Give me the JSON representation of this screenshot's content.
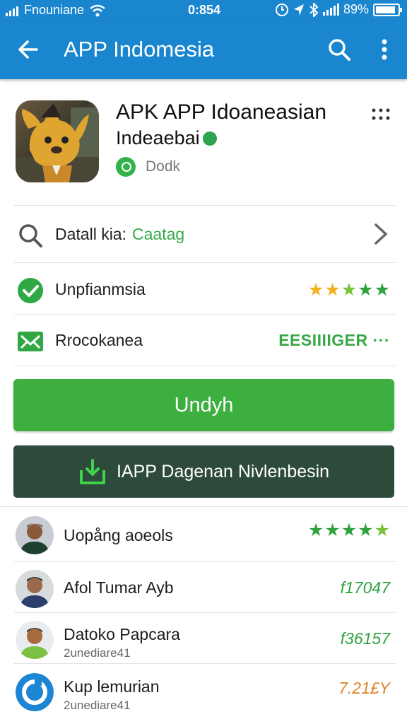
{
  "status_bar": {
    "carrier": "Fnouniane",
    "time": "0:854",
    "battery": "89%",
    "battery_level": 0.89
  },
  "app_bar": {
    "title": "APP Indomesia",
    "back_icon": "arrow-left-icon",
    "search_icon": "search-icon",
    "more_icon": "more-vert-icon"
  },
  "app": {
    "name": "APK APP Idoaneasian",
    "subtitle": "Indeaebai",
    "developer": "Dodk",
    "icon": "mascot-app-icon"
  },
  "info_rows": [
    {
      "label": "Datall kia:",
      "value": "Caatag",
      "icon": "search-icon"
    },
    {
      "label": "Unpfianmsia",
      "icon": "check-circle-icon",
      "rating": 5
    },
    {
      "label": "Rrocokanea",
      "icon": "mail-icon",
      "value": "EESIIIIGER ···"
    }
  ],
  "buttons": {
    "download": "Undyh",
    "secondary": "IAPP Dagenan Nivlenbesin"
  },
  "reviews": [
    {
      "name": "Uopång aoeols",
      "rating": 5,
      "score": ""
    },
    {
      "name": "Afol Tumar Ayb",
      "sub": "",
      "score": "f17047"
    },
    {
      "name": "Datoko Papcara",
      "sub": "2unediare41",
      "score": "f36157"
    },
    {
      "name": "Kup lemurian",
      "sub": "2unediare41",
      "score": "7.21£Y"
    }
  ],
  "colors": {
    "primary": "#1a86cf",
    "accent_green": "#3caf3f",
    "dark_green": "#2d4a3b",
    "star_gold": "#f2b21c",
    "star_green": "#2fa23f",
    "score_orange": "#e0812b"
  }
}
